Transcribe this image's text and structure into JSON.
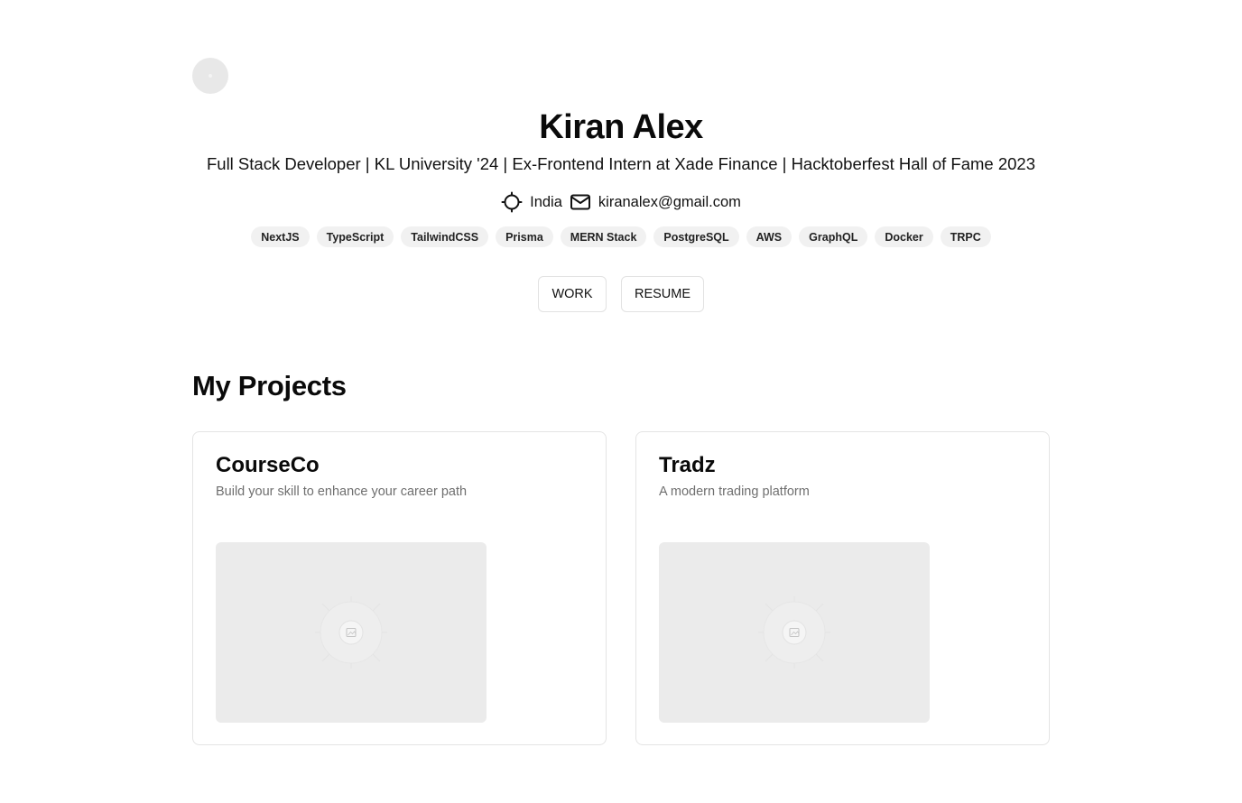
{
  "profile": {
    "name": "Kiran Alex",
    "tagline": "Full Stack Developer | KL University '24 | Ex-Frontend Intern at Xade Finance | Hacktoberfest Hall of Fame 2023",
    "location": "India",
    "email": "kiranalex@gmail.com"
  },
  "skills": [
    "NextJS",
    "TypeScript",
    "TailwindCSS",
    "Prisma",
    "MERN Stack",
    "PostgreSQL",
    "AWS",
    "GraphQL",
    "Docker",
    "TRPC"
  ],
  "actions": {
    "work_label": "WORK",
    "resume_label": "RESUME"
  },
  "projects_section": {
    "title": "My Projects",
    "items": [
      {
        "title": "CourseCo",
        "description": "Build your skill to enhance your career path"
      },
      {
        "title": "Tradz",
        "description": "A modern trading platform"
      }
    ]
  },
  "icons": {
    "location": "crosshair-icon",
    "email": "mail-icon",
    "placeholder": "image-placeholder-icon"
  }
}
